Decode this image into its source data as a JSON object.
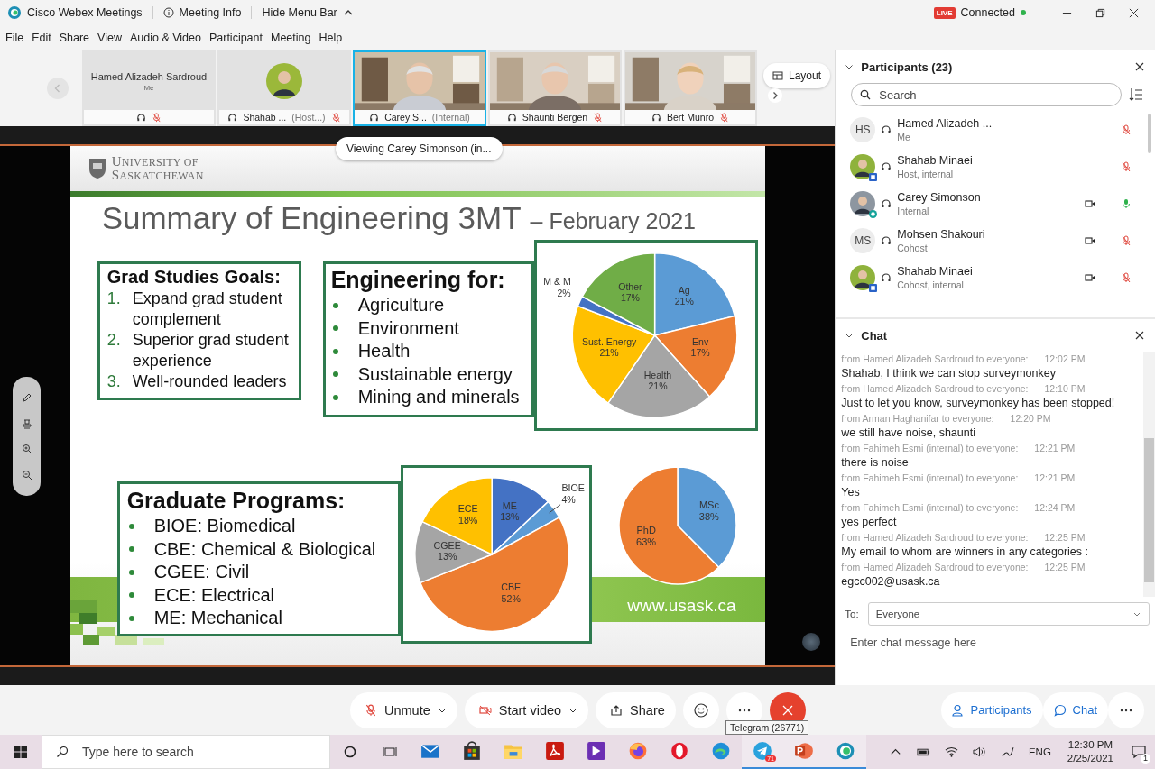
{
  "title_bar": {
    "app_name": "Cisco Webex Meetings",
    "meeting_info": "Meeting Info",
    "hide_menu": "Hide Menu Bar",
    "live_badge": "LIVE",
    "status": "Connected"
  },
  "menu": [
    "File",
    "Edit",
    "Share",
    "View",
    "Audio & Video",
    "Participant",
    "Meeting",
    "Help"
  ],
  "video_strip": {
    "layout_button": "Layout",
    "tiles": [
      {
        "kind": "no_video",
        "name": "Hamed Alizadeh Sardroud",
        "role": "Me",
        "muted": true,
        "selected": false
      },
      {
        "kind": "avatar",
        "name": "Shahab ...",
        "role": "(Host...)",
        "muted": true,
        "selected": false
      },
      {
        "kind": "video",
        "name": "Carey S...",
        "role": "(Internal)",
        "muted": false,
        "selected": true
      },
      {
        "kind": "video",
        "name": "Shaunti Bergen",
        "muted": true,
        "selected": false
      },
      {
        "kind": "video",
        "name": "Bert Munro",
        "muted": true,
        "selected": false
      }
    ]
  },
  "stage": {
    "viewing_label": "Viewing Carey Simonson (in...",
    "slide": {
      "logo_line1": "UNIVERSITY OF",
      "logo_line2": "SASKATCHEWAN",
      "title": "Summary of Engineering 3MT",
      "subtitle": "– February 2021",
      "goals": {
        "heading": "Grad Studies Goals:",
        "items": [
          {
            "number": "1.",
            "text": "Expand grad student complement"
          },
          {
            "number": "2.",
            "text": "Superior grad student experience"
          },
          {
            "number": "3.",
            "text": "Well-rounded leaders"
          }
        ]
      },
      "engineering_for": {
        "heading": "Engineering for:",
        "items": [
          "Agriculture",
          "Environment",
          "Health",
          "Sustainable energy",
          "Mining and minerals"
        ]
      },
      "focus_chart": {
        "chart_data": {
          "type": "pie",
          "categories": [
            "Ag",
            "Env",
            "Health",
            "Sust. Energy",
            "M & M",
            "Other"
          ],
          "values": [
            21,
            17,
            21,
            21,
            2,
            17
          ],
          "value_labels": [
            "21%",
            "17%",
            "21%",
            "21%",
            "2%",
            "17%"
          ],
          "colors": [
            "#5b9bd5",
            "#ed7d31",
            "#a5a5a5",
            "#ffc000",
            "#4472c4",
            "#70ad47"
          ]
        }
      },
      "programs": {
        "heading": "Graduate Programs:",
        "items": [
          "BIOE: Biomedical",
          "CBE: Chemical & Biological",
          "CGEE: Civil",
          "ECE: Electrical",
          "ME: Mechanical"
        ]
      },
      "programs_chart": {
        "chart_data": {
          "type": "pie",
          "categories": [
            "ME",
            "BIOE",
            "CBE",
            "CGEE",
            "ECE"
          ],
          "values": [
            13,
            4,
            52,
            13,
            18
          ],
          "value_labels": [
            "13%",
            "4%",
            "52%",
            "13%",
            "18%"
          ],
          "colors": [
            "#4472c4",
            "#5b9bd5",
            "#ed7d31",
            "#a5a5a5",
            "#ffc000"
          ]
        }
      },
      "degree_chart": {
        "chart_data": {
          "type": "pie",
          "categories": [
            "MSc",
            "PhD"
          ],
          "values": [
            38,
            63
          ],
          "value_labels": [
            "38%",
            "63%"
          ],
          "colors": [
            "#5b9bd5",
            "#ed7d31"
          ]
        }
      },
      "footer_url": "www.usask.ca"
    }
  },
  "participants": {
    "title": "Participants (23)",
    "search_placeholder": "Search",
    "items": [
      {
        "name": "Hamed Alizadeh ...",
        "role": "Me",
        "avatar": {
          "kind": "initials",
          "text": "HS"
        },
        "host_badge": false,
        "presenter_badge": false,
        "video": false,
        "muted": true
      },
      {
        "name": "Shahab Minaei",
        "role": "Host, internal",
        "host_badge": true,
        "presenter_badge": false,
        "video": false,
        "muted": true
      },
      {
        "name": "Carey Simonson",
        "role": "Internal",
        "host_badge": false,
        "presenter_badge": true,
        "video": true,
        "muted": false
      },
      {
        "name": "Mohsen Shakouri",
        "role": "Cohost",
        "avatar": {
          "kind": "initials",
          "text": "MS"
        },
        "host_badge": false,
        "presenter_badge": false,
        "video": true,
        "muted": true
      },
      {
        "name": "Shahab Minaei",
        "role": "Cohost, internal",
        "host_badge": true,
        "presenter_badge": false,
        "video": true,
        "muted": true
      }
    ]
  },
  "chat": {
    "title": "Chat",
    "messages": [
      {
        "from": "from Hamed Alizadeh Sardroud to everyone:",
        "time": "12:02 PM",
        "text": "Shahab, I think we can stop surveymonkey"
      },
      {
        "from": "from Hamed Alizadeh Sardroud to everyone:",
        "time": "12:10 PM",
        "text": "Just to let you know, surveymonkey has been stopped!"
      },
      {
        "from": "from Arman Haghanifar to everyone:",
        "time": "12:20 PM",
        "text": "we still have noise, shaunti"
      },
      {
        "from": "from Fahimeh Esmi (internal) to everyone:",
        "time": "12:21 PM",
        "text": "there is noise"
      },
      {
        "from": "from Fahimeh Esmi (internal) to everyone:",
        "time": "12:21 PM",
        "text": "Yes"
      },
      {
        "from": "from Fahimeh Esmi (internal) to everyone:",
        "time": "12:24 PM",
        "text": "yes perfect"
      },
      {
        "from": "from Hamed Alizadeh Sardroud to everyone:",
        "time": "12:25 PM",
        "text": "My email to whom are winners in any categories :"
      },
      {
        "from": "from Hamed Alizadeh Sardroud to everyone:",
        "time": "12:25 PM",
        "text": "egcc002@usask.ca"
      }
    ],
    "to_label": "To:",
    "to_value": "Everyone",
    "placeholder": "Enter chat message here"
  },
  "controls": {
    "unmute": "Unmute",
    "start_video": "Start video",
    "share": "Share",
    "participants": "Participants",
    "chat": "Chat",
    "tooltip": "Telegram (26771)"
  },
  "taskbar": {
    "search_placeholder": "Type here to search",
    "apps": [
      {
        "kind": "mail",
        "running": false
      },
      {
        "kind": "store",
        "running": false
      },
      {
        "kind": "explorer",
        "running": false
      },
      {
        "kind": "pdf",
        "running": false
      },
      {
        "kind": "studio",
        "running": false
      },
      {
        "kind": "firefox",
        "running": false
      },
      {
        "kind": "opera",
        "running": false
      },
      {
        "kind": "edge",
        "running": false
      },
      {
        "kind": "telegram",
        "running": true,
        "badge": "71"
      },
      {
        "kind": "powerpoint",
        "running": true
      },
      {
        "kind": "webex",
        "running": true
      }
    ],
    "language": "ENG",
    "time": "12:30 PM",
    "date": "2/25/2021",
    "notifications": "1"
  }
}
